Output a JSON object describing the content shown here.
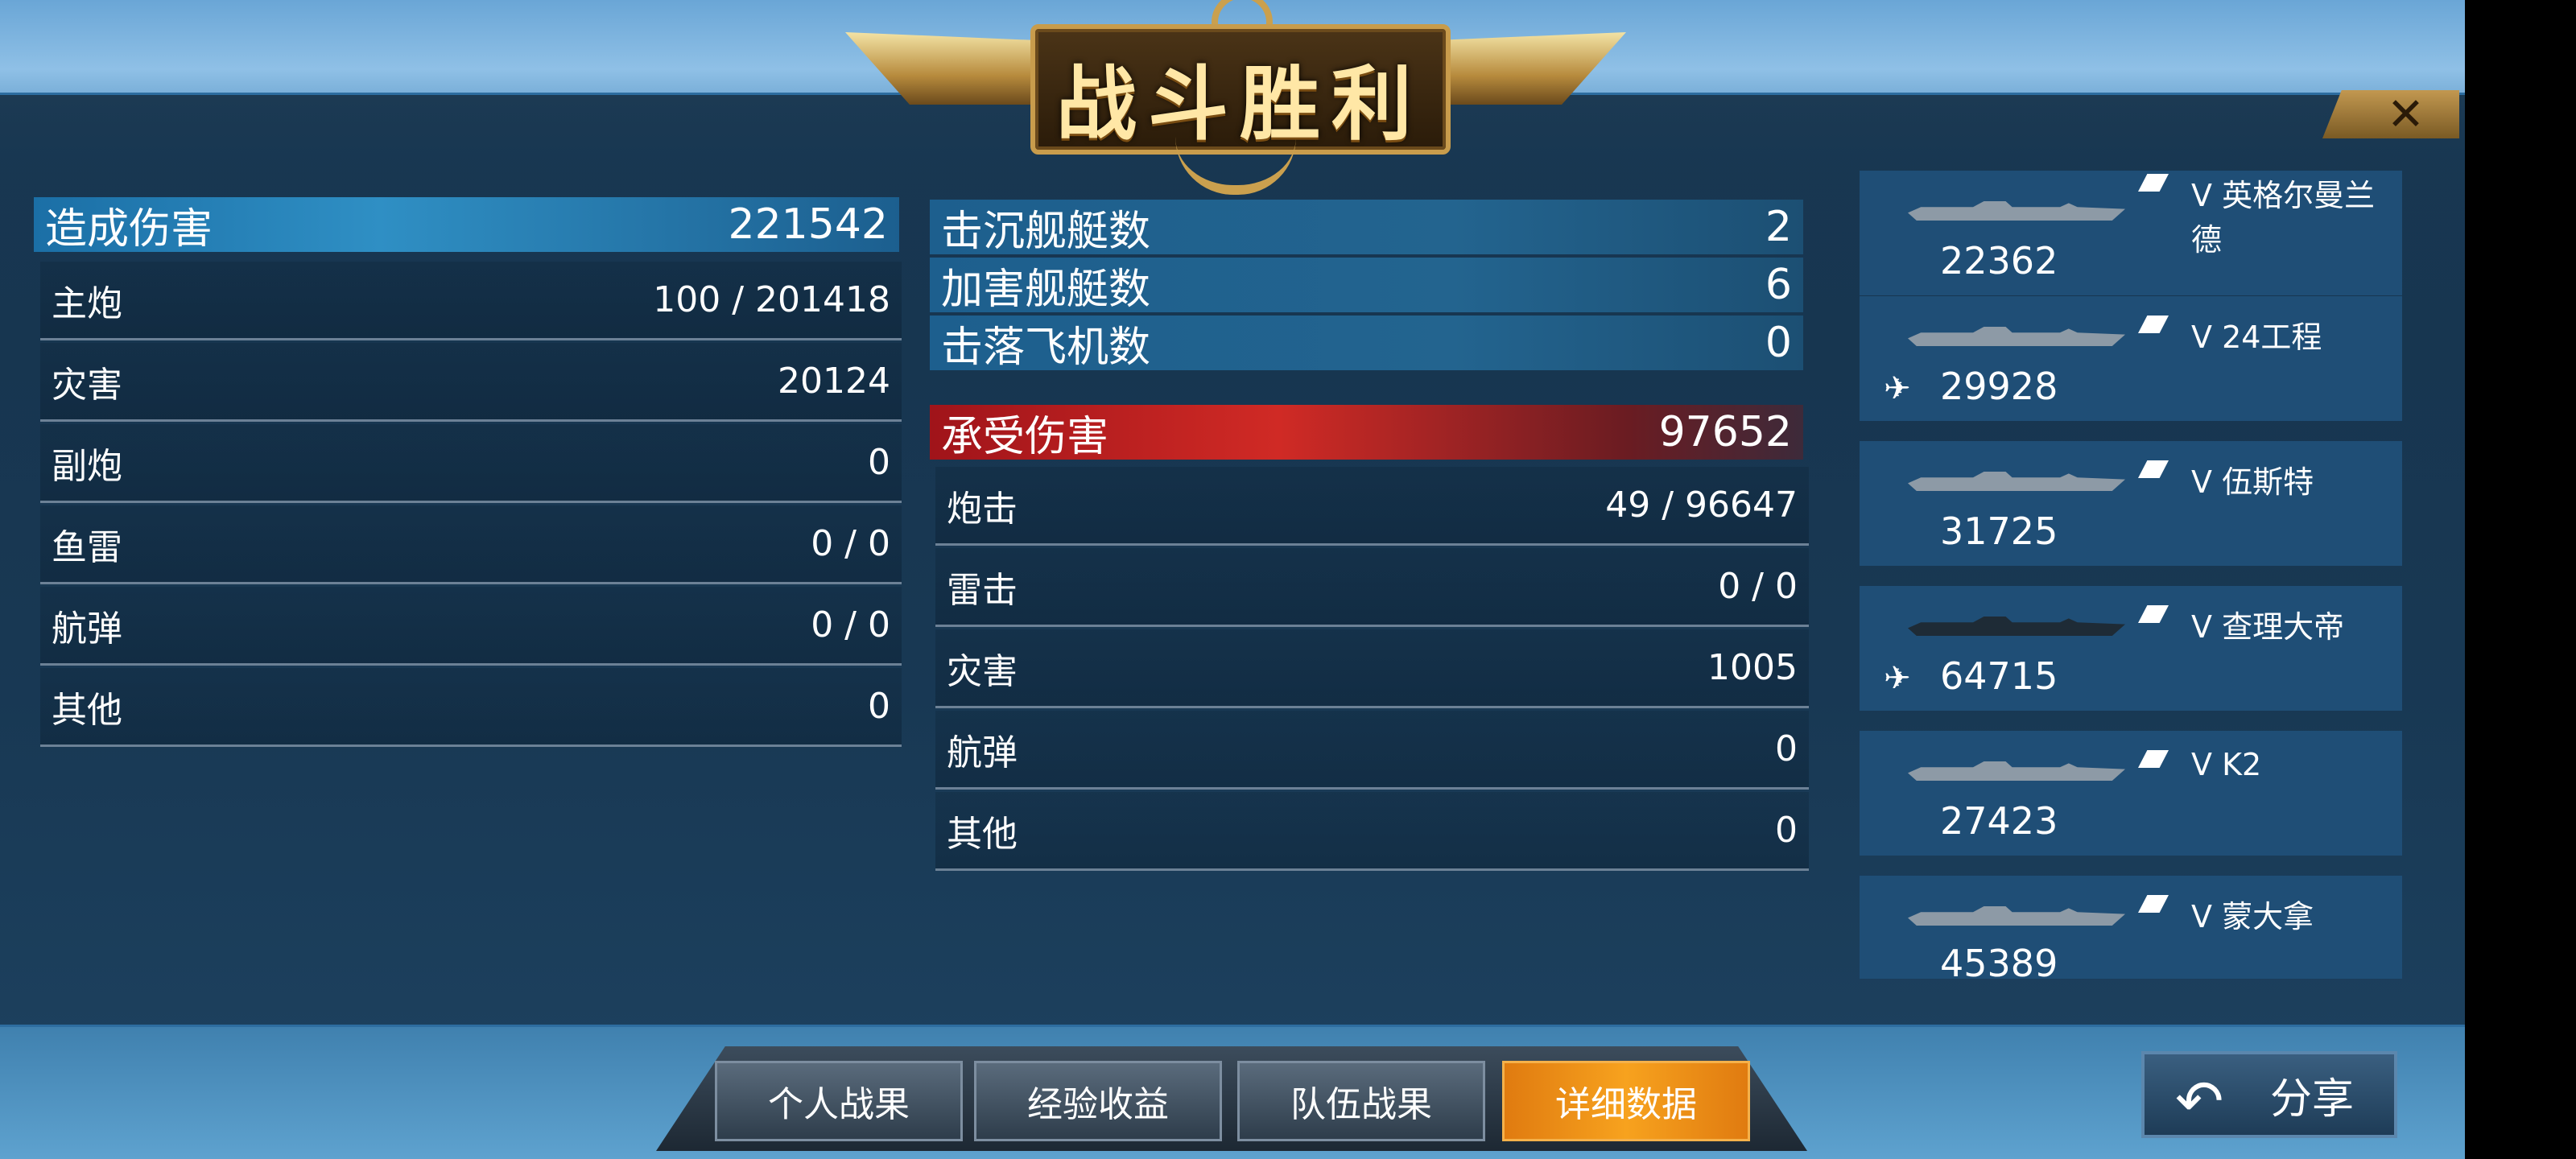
{
  "title": "战斗胜利",
  "close_symbol": "✕",
  "damage_dealt": {
    "label": "造成伤害",
    "value": "221542",
    "rows": [
      {
        "label": "主炮",
        "value": "100 / 201418"
      },
      {
        "label": "灾害",
        "value": "20124"
      },
      {
        "label": "副炮",
        "value": "0"
      },
      {
        "label": "鱼雷",
        "value": "0 / 0"
      },
      {
        "label": "航弹",
        "value": "0 / 0"
      },
      {
        "label": "其他",
        "value": "0"
      }
    ]
  },
  "summary": [
    {
      "label": "击沉舰艇数",
      "value": "2"
    },
    {
      "label": "加害舰艇数",
      "value": "6"
    },
    {
      "label": "击落飞机数",
      "value": "0"
    }
  ],
  "damage_taken": {
    "label": "承受伤害",
    "value": "97652",
    "rows": [
      {
        "label": "炮击",
        "value": "49 / 96647"
      },
      {
        "label": "雷击",
        "value": "0 / 0"
      },
      {
        "label": "灾害",
        "value": "1005"
      },
      {
        "label": "航弹",
        "value": "0"
      },
      {
        "label": "其他",
        "value": "0"
      }
    ]
  },
  "ships": [
    {
      "name": "V 英格尔曼兰德",
      "damage": "22362",
      "plane": false,
      "dark": false
    },
    {
      "name": "V 24工程",
      "damage": "29928",
      "plane": true,
      "dark": false
    },
    {
      "name": "V 伍斯特",
      "damage": "31725",
      "plane": false,
      "dark": false
    },
    {
      "name": "V 查理大帝",
      "damage": "64715",
      "plane": true,
      "dark": true
    },
    {
      "name": "V K2",
      "damage": "27423",
      "plane": false,
      "dark": false
    },
    {
      "name": "V 蒙大拿",
      "damage": "45389",
      "plane": false,
      "dark": false
    }
  ],
  "tabs": [
    {
      "label": "个人战果"
    },
    {
      "label": "经验收益"
    },
    {
      "label": "队伍战果"
    },
    {
      "label": "详细数据",
      "active": true
    }
  ],
  "share_label": "分享",
  "colors": {
    "accent_orange": "#f7a21e",
    "header_blue": "#2f8fc4",
    "header_red": "#d02a25",
    "gold": "#c89c4c"
  }
}
